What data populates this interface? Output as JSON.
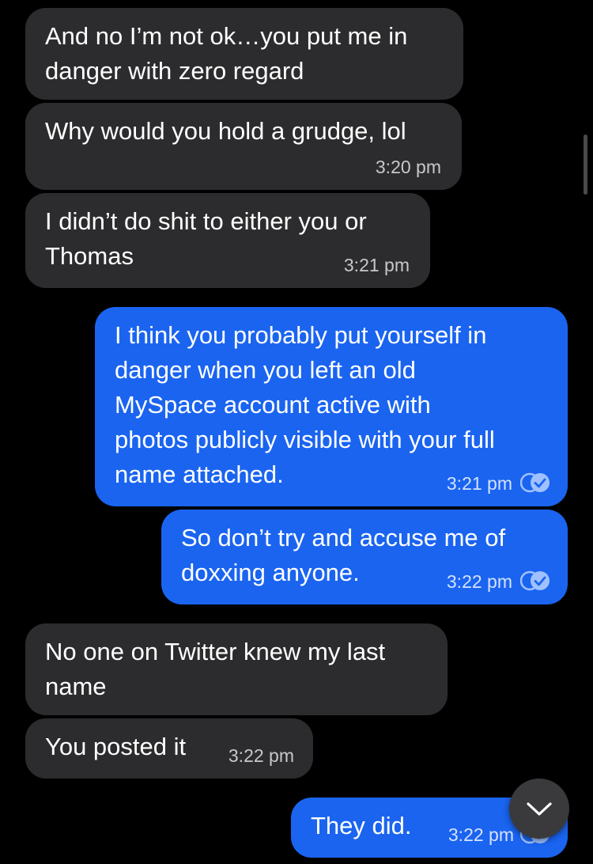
{
  "colors": {
    "background": "#000000",
    "incoming_bubble": "#2c2c2e",
    "outgoing_bubble": "#1a64f0",
    "read_receipt": "#9fc1ff"
  },
  "messages": [
    {
      "direction": "incoming",
      "text": "And no I’m not ok…you put me in\ndanger with zero regard",
      "time": ""
    },
    {
      "direction": "incoming",
      "text": "Why would you hold a grudge, lol",
      "time": "3:20 pm"
    },
    {
      "direction": "incoming",
      "text": "I didn’t do shit to either you or\nThomas",
      "time": "3:21 pm"
    },
    {
      "direction": "outgoing",
      "text": "I think you probably put yourself in\ndanger when you left an old\nMySpace account active with\nphotos publicly visible with your full\nname attached.",
      "time": "3:21 pm",
      "receipt": "read-check-icon"
    },
    {
      "direction": "outgoing",
      "text": "So don’t try and accuse me of\ndoxxing anyone.",
      "time": "3:22 pm",
      "receipt": "read-check-icon"
    },
    {
      "direction": "incoming",
      "text": "No one on Twitter knew my last\nname",
      "time": ""
    },
    {
      "direction": "incoming",
      "text": "You posted it",
      "time": "3:22 pm"
    },
    {
      "direction": "outgoing",
      "text": "They did.",
      "time": "3:22 pm",
      "receipt": "read-check-icon"
    }
  ],
  "scroll_down_icon": "chevron-down-icon"
}
